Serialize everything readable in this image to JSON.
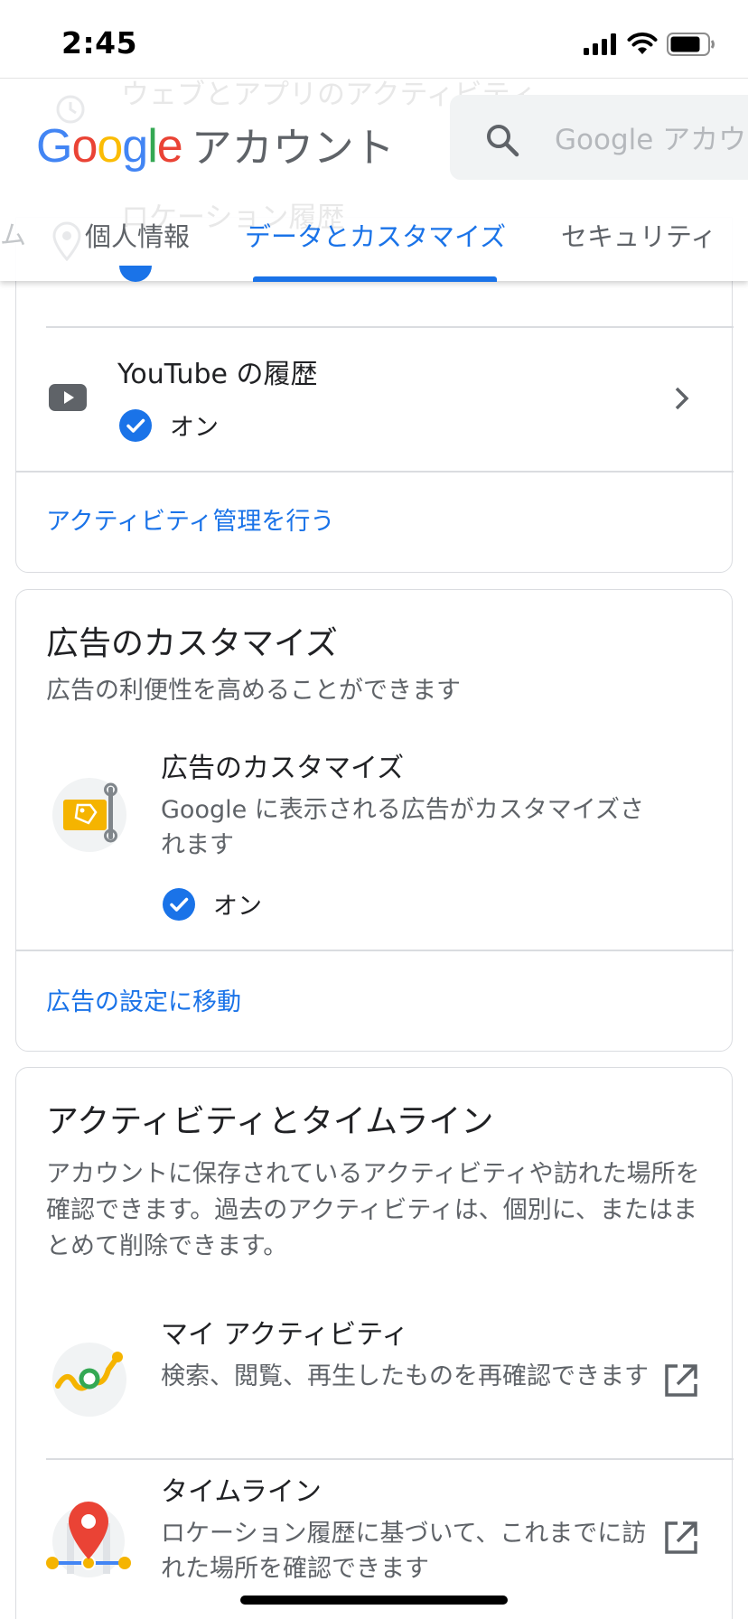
{
  "status_bar": {
    "time": "2:45"
  },
  "header": {
    "ghost_title": "ウェブとアプリのアクティビティ",
    "ghost_title2": "ロケーション履歴",
    "brand_letters": [
      "G",
      "o",
      "o",
      "g",
      "l",
      "e"
    ],
    "brand_colors": [
      "#4285F4",
      "#EA4335",
      "#FBBC05",
      "#4285F4",
      "#34A853",
      "#EA4335"
    ],
    "brand_suffix": "アカウント",
    "search_placeholder": "Google アカウ",
    "tab_fade": "ム",
    "tabs": [
      {
        "label": "個人情報"
      },
      {
        "label": "データとカスタマイズ"
      },
      {
        "label": "セキュリティ"
      }
    ]
  },
  "activity_card": {
    "youtube": {
      "title": "YouTube の履歴",
      "status": "オン"
    },
    "manage_link": "アクティビティ管理を行う"
  },
  "ads_card": {
    "title": "広告のカスタマイズ",
    "subtitle": "広告の利便性を高めることができます",
    "item": {
      "title": "広告のカスタマイズ",
      "desc": "Google に表示される広告がカスタマイズされます",
      "status": "オン"
    },
    "settings_link": "広告の設定に移動"
  },
  "timeline_card": {
    "title": "アクティビティとタイムライン",
    "subtitle": "アカウントに保存されているアクティビティや訪れた場所を確認できます。過去のアクティビティは、個別に、またはまとめて削除できます。",
    "items": [
      {
        "title": "マイ アクティビティ",
        "desc": "検索、閲覧、再生したものを再確認できます"
      },
      {
        "title": "タイムライン",
        "desc": "ロケーション履歴に基づいて、これまでに訪れた場所を確認できます"
      }
    ]
  },
  "colors": {
    "accent": "#1a73e8",
    "text": "#202124",
    "secondary": "#5f6368",
    "border": "#dadce0"
  },
  "icons": [
    "signal-icon",
    "wifi-icon",
    "battery-icon",
    "search-icon",
    "youtube-icon",
    "check-icon",
    "chevron-right-icon",
    "ads-icon",
    "my-activity-icon",
    "timeline-icon",
    "external-link-icon"
  ]
}
